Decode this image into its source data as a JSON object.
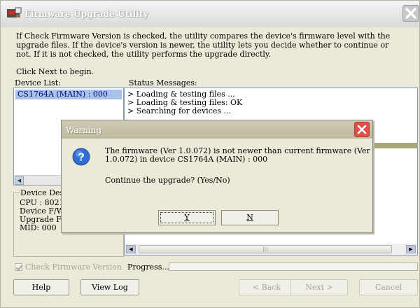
{
  "window": {
    "title": "Firmware Upgrade Utility",
    "intro_text": "If Check Firmware Version is checked, the utility compares the device's firmware level with the upgrade files. If the device's version is newer, the utility lets you decide whether to continue or not. If it is not checked, the utility performs the upgrade directly.",
    "begin_text": "Click Next to begin."
  },
  "device_list": {
    "label": "Device List:",
    "items": [
      {
        "label": "CS1764A (MAIN) : 000",
        "selected": true
      }
    ]
  },
  "status": {
    "label": "Status Messages:",
    "lines": [
      "> Loading & testing files ...",
      "> Loading & testing files: OK",
      "> Searching for devices ..."
    ]
  },
  "device_description": {
    "legend": "Device Desc",
    "lines": [
      "CPU : 8021/",
      "Device F/W:",
      "Upgrade F/W",
      "MID: 000"
    ]
  },
  "options": {
    "check_firmware_label": "Check Firmware Version",
    "check_firmware_checked": true,
    "progress_label": "Progress..."
  },
  "buttons": {
    "help": "Help",
    "view_log": "View Log",
    "back": "< Back",
    "next": "Next >",
    "cancel": "Cancel"
  },
  "warning_dialog": {
    "title": "Warning",
    "message": "The firmware (Ver 1.0.072) is not newer than current firmware (Ver 1.0.072) in device CS1764A (MAIN) : 000",
    "question": "Continue the upgrade? (Yes/No)",
    "yes_label": "Y",
    "no_label": "N"
  },
  "colors": {
    "window_bg": "#ece9d8",
    "selection": "#a9c3e8",
    "close_red": "#e2504a",
    "question_blue": "#2f6fd3"
  },
  "icons": [
    "app-icon",
    "close-icon",
    "question-icon",
    "scroll-left-icon",
    "scroll-right-icon"
  ]
}
